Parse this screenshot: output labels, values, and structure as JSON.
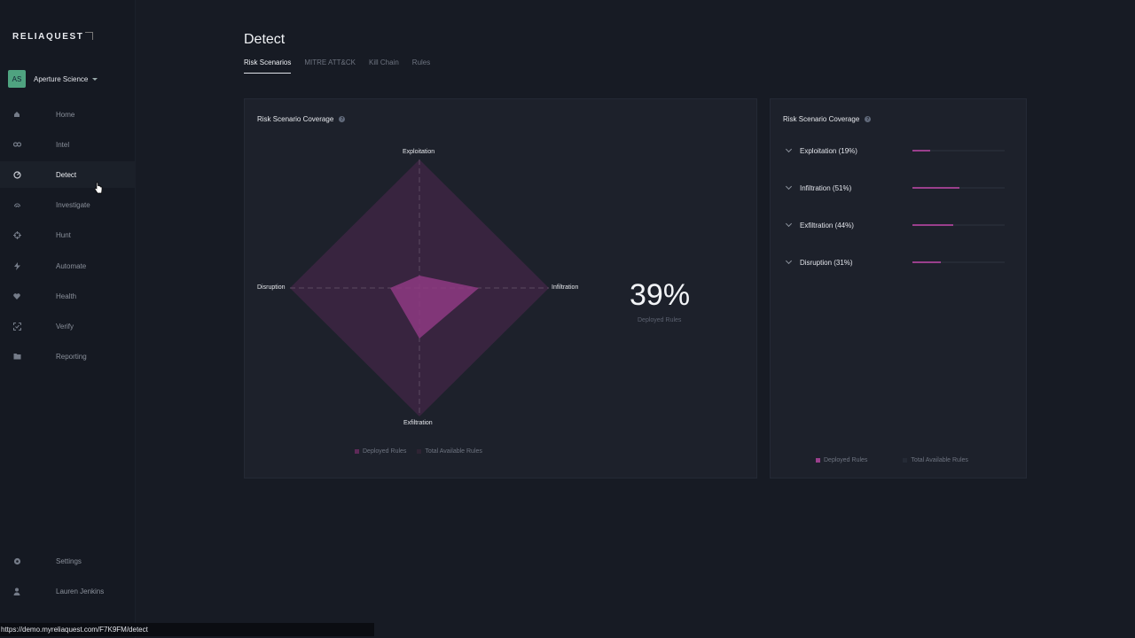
{
  "brand": {
    "logo_text": "RELIAQUEST"
  },
  "org": {
    "initials": "AS",
    "name": "Aperture Science"
  },
  "nav": {
    "items": [
      {
        "label": "Home",
        "icon": "home-icon"
      },
      {
        "label": "Intel",
        "icon": "intel-icon"
      },
      {
        "label": "Detect",
        "icon": "detect-icon"
      },
      {
        "label": "Investigate",
        "icon": "fingerprint-icon"
      },
      {
        "label": "Hunt",
        "icon": "crosshair-icon"
      },
      {
        "label": "Automate",
        "icon": "bolt-icon"
      },
      {
        "label": "Health",
        "icon": "heart-icon"
      },
      {
        "label": "Verify",
        "icon": "scan-icon"
      },
      {
        "label": "Reporting",
        "icon": "folder-icon"
      }
    ],
    "active": "Detect",
    "bottom": [
      {
        "label": "Settings",
        "icon": "gear-icon"
      },
      {
        "label": "Lauren Jenkins",
        "icon": "user-icon"
      }
    ]
  },
  "page": {
    "title": "Detect",
    "tabs": [
      "Risk Scenarios",
      "MITRE ATT&CK",
      "Kill Chain",
      "Rules"
    ],
    "active_tab": "Risk Scenarios"
  },
  "radar_card": {
    "title": "Risk Scenario Coverage",
    "axes": {
      "top": "Exploitation",
      "right": "Infiltration",
      "bottom": "Exfiltration",
      "left": "Disruption"
    },
    "deployed_percent": "39%",
    "deployed_label": "Deployed Rules",
    "legend": [
      "Deployed Rules",
      "Total Available Rules"
    ]
  },
  "coverage_card": {
    "title": "Risk Scenario Coverage",
    "rows": [
      {
        "label": "Exploitation (19%)",
        "value": 0.19
      },
      {
        "label": "Infiltration (51%)",
        "value": 0.51
      },
      {
        "label": "Exfiltration (44%)",
        "value": 0.44
      },
      {
        "label": "Disruption (31%)",
        "value": 0.31
      }
    ],
    "legend": [
      "Deployed Rules",
      "Total Available Rules"
    ]
  },
  "colors": {
    "deployed": "#9a3f8c",
    "total": "#4a2a4a",
    "accent_avatar": "#4fa380"
  },
  "status_url": "https://demo.myreliaquest.com/F7K9FM/detect"
}
